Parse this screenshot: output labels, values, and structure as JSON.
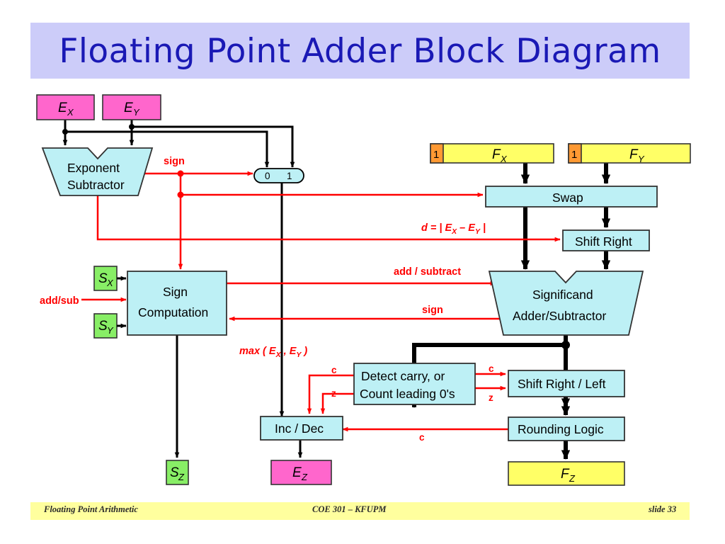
{
  "slide": {
    "title": "Floating Point Adder Block Diagram",
    "title_bg": "#ccccf9",
    "title_color": "#1a19b5"
  },
  "footer": {
    "left": "Floating Point Arithmetic",
    "center": "COE 301 – KFUPM",
    "right": "slide 33",
    "bg": "#ffff9e"
  },
  "colors": {
    "block_fill": "#bdf0f5",
    "exponent_fill": "#ff66cc",
    "sign_fill": "#88ee66",
    "fraction_fill": "#ffff66",
    "hidden_bit_fill": "#ff9933",
    "signal_red": "#ff0000",
    "wire_black": "#000000",
    "outline": "#333333"
  },
  "inputs": {
    "exponent_x": {
      "label": "E",
      "sub": "X"
    },
    "exponent_y": {
      "label": "E",
      "sub": "Y"
    },
    "sign_x": {
      "label": "S",
      "sub": "X"
    },
    "sign_y": {
      "label": "S",
      "sub": "Y"
    },
    "fraction_x": {
      "hidden_bit": "1",
      "label": "F",
      "sub": "X"
    },
    "fraction_y": {
      "hidden_bit": "1",
      "label": "F",
      "sub": "Y"
    }
  },
  "outputs": {
    "sign_z": {
      "label": "S",
      "sub": "Z"
    },
    "exponent_z": {
      "label": "E",
      "sub": "Z"
    },
    "fraction_z": {
      "label": "F",
      "sub": "Z"
    }
  },
  "blocks": {
    "exponent_subtractor": {
      "line1": "Exponent",
      "line2": "Subtractor"
    },
    "sign_computation": {
      "line1": "Sign",
      "line2": "Computation"
    },
    "swap": {
      "line1": "Swap"
    },
    "shift_right": {
      "line1": "Shift Right"
    },
    "significand_adder": {
      "line1": "Significand",
      "line2": "Adder/Subtractor"
    },
    "detect_carry": {
      "line1": "Detect carry, or",
      "line2": "Count leading 0's"
    },
    "shift_right_left": {
      "line1": "Shift Right / Left"
    },
    "rounding_logic": {
      "line1": "Rounding Logic"
    },
    "inc_dec": {
      "line1": "Inc / Dec"
    }
  },
  "mux": {
    "input_0": "0",
    "input_1": "1"
  },
  "signals": {
    "sign_from_subtractor": "sign",
    "add_sub_input": "add/sub",
    "difference": {
      "text": "d = | E",
      "sub1": "X",
      "mid": " – E",
      "sub2": "Y",
      "end": " |"
    },
    "add_subtract": "add / subtract",
    "sign_to_adder": "sign",
    "max_exponent": {
      "text": "max ( E",
      "sub1": "X",
      "mid": " , E",
      "sub2": "Y",
      "end": " )"
    },
    "carry_left": "c",
    "zero_left": "z",
    "carry_right": "c",
    "zero_right": "z",
    "carry_round": "c"
  }
}
